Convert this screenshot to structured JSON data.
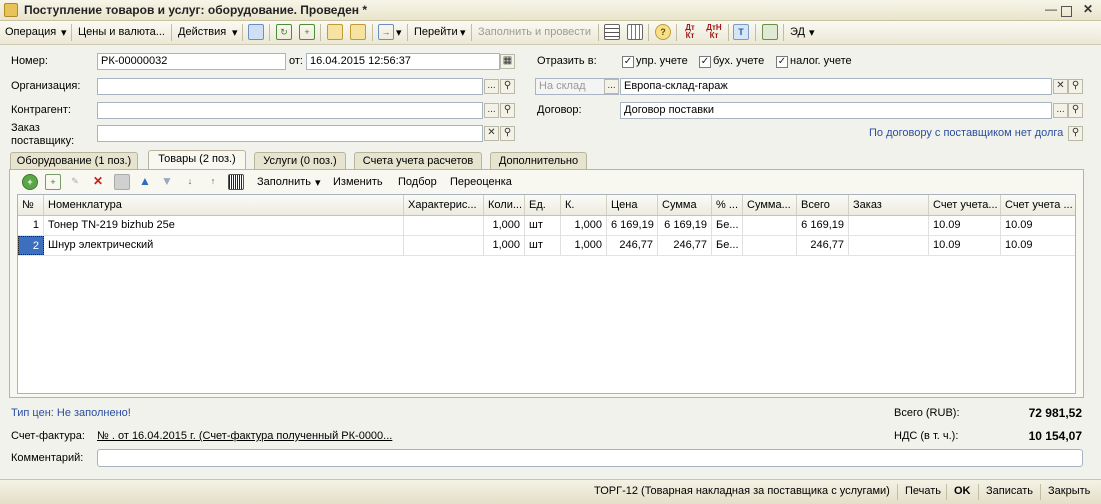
{
  "window": {
    "title": "Поступление товаров и услуг: оборудование. Проведен *"
  },
  "toolbar": {
    "operation": "Операция",
    "prices": "Цены и валюта...",
    "actions": "Действия",
    "goto": "Перейти",
    "fill_post": "Заполнить и провести",
    "ed": "ЭД"
  },
  "form": {
    "number_label": "Номер:",
    "number_value": "РК-00000032",
    "date_label": "от:",
    "date_value": "16.04.2015 12:56:37",
    "reflect_label": "Отразить в:",
    "reflect_options": [
      "упр. учете",
      "бух. учете",
      "налог. учете"
    ],
    "org_label": "Организация:",
    "org_value": "",
    "warehouse_placeholder": "На склад",
    "warehouse_value": "Европа-склад-гараж",
    "contractor_label": "Контрагент:",
    "contractor_value": "",
    "contract_label": "Договор:",
    "contract_value": "Договор поставки",
    "order_label_1": "Заказ",
    "order_label_2": "поставщику:",
    "order_value": "",
    "debt_link": "По договору с поставщиком нет долга"
  },
  "tabs": [
    "Оборудование (1 поз.)",
    "Товары (2 поз.)",
    "Услуги (0 поз.)",
    "Счета учета расчетов",
    "Дополнительно"
  ],
  "table_toolbar": {
    "fill": "Заполнить",
    "change": "Изменить",
    "select": "Подбор",
    "reprice": "Переоценка"
  },
  "table": {
    "columns": [
      "№",
      "Номенклатура",
      "Характерис...",
      "Коли...",
      "Ед.",
      "К.",
      "Цена",
      "Сумма",
      "% ...",
      "Сумма...",
      "Всего",
      "Заказ",
      "Счет учета...",
      "Счет учета ..."
    ],
    "rows": [
      [
        "1",
        "Тонер TN-219 bizhub 25e",
        "",
        "1,000",
        "шт",
        "1,000",
        "6 169,19",
        "6 169,19",
        "Бе...",
        "",
        "6 169,19",
        "",
        "10.09",
        "10.09"
      ],
      [
        "2",
        "Шнур электрический",
        "",
        "1,000",
        "шт",
        "1,000",
        "246,77",
        "246,77",
        "Бе...",
        "",
        "246,77",
        "",
        "10.09",
        "10.09"
      ]
    ]
  },
  "footer": {
    "price_type_link": "Тип цен: Не заполнено!",
    "total_label": "Всего (RUB):",
    "total_value": "72 981,52",
    "vat_label": "НДС (в т. ч.):",
    "vat_value": "10 154,07",
    "invoice_label": "Счет-фактура:",
    "invoice_link": "№ . от 16.04.2015 г. (Счет-фактура полученный РК-0000...",
    "comment_label": "Комментарий:",
    "comment_value": ""
  },
  "statusbar": {
    "torg": "ТОРГ-12 (Товарная накладная за поставщика с услугами)",
    "print": "Печать",
    "ok": "OK",
    "save": "Записать",
    "close": "Закрыть"
  }
}
